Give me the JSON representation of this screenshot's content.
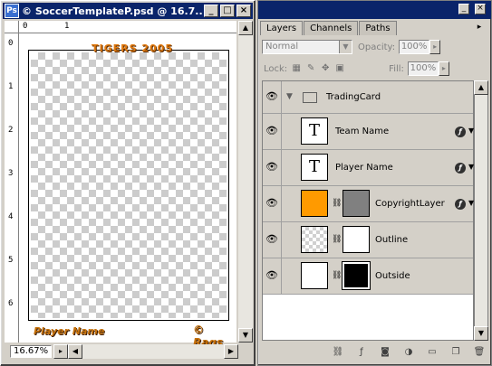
{
  "document": {
    "title": "© SoccerTemplateP.psd @ 16.7...",
    "app_icon": "Ps",
    "window_buttons": {
      "minimize": "_",
      "maximize": "□",
      "close": "×"
    },
    "zoom": "16.67%",
    "ruler_top_marks": [
      "0",
      "1"
    ],
    "ruler_left_marks": [
      "0",
      "1",
      "2",
      "3",
      "4",
      "5",
      "6"
    ],
    "card_title": "TIGERS 2005",
    "card_player_name": "Player Name",
    "card_brand": "© Rags"
  },
  "palette": {
    "tabs": [
      {
        "label": "Layers",
        "active": true
      },
      {
        "label": "Channels",
        "active": false
      },
      {
        "label": "Paths",
        "active": false
      }
    ],
    "blend_mode": "Normal",
    "opacity_label": "Opacity:",
    "opacity_value": "100%",
    "lock_label": "Lock:",
    "fill_label": "Fill:",
    "fill_value": "100%",
    "group_name": "TradingCard",
    "layers": [
      {
        "name": "Team Name",
        "kind": "text",
        "fx": true
      },
      {
        "name": "Player Name",
        "kind": "text",
        "fx": true
      },
      {
        "name": "CopyrightLayer",
        "kind": "masked",
        "fx": true
      },
      {
        "name": "Outline",
        "kind": "masked",
        "fx": false
      },
      {
        "name": "Outside",
        "kind": "masked",
        "fx": false
      }
    ],
    "text_thumb_glyph": "T"
  }
}
